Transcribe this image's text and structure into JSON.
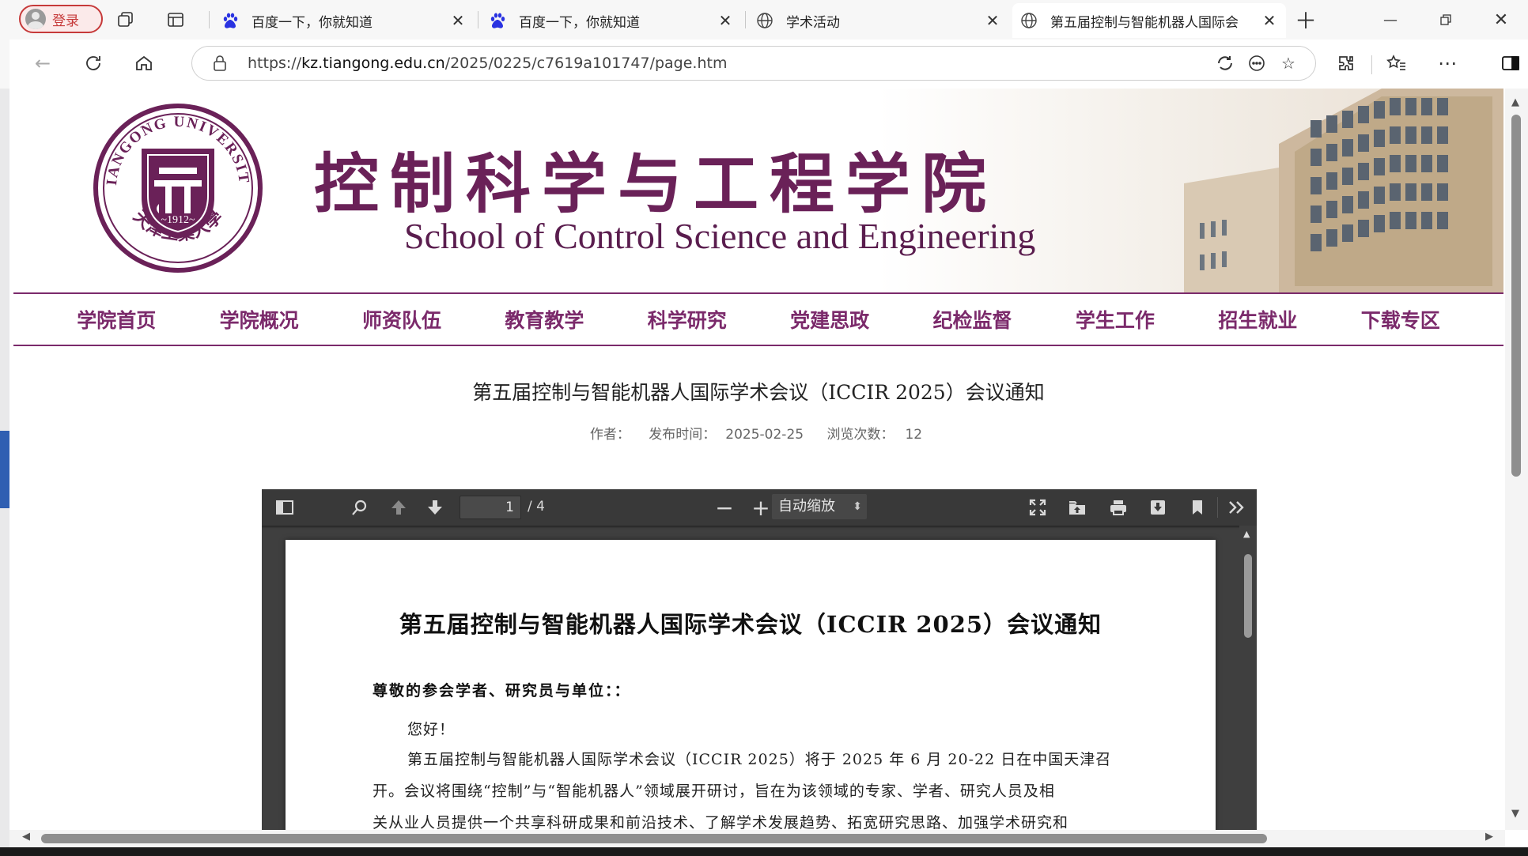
{
  "browser": {
    "profile_label": "登录",
    "tabs": [
      {
        "title": "百度一下，你就知道",
        "icon": "baidu-icon"
      },
      {
        "title": "百度一下，你就知道",
        "icon": "baidu-icon"
      },
      {
        "title": "学术活动",
        "icon": "globe-icon"
      },
      {
        "title": "第五届控制与智能机器人国际会",
        "icon": "globe-icon",
        "active": true
      }
    ],
    "url_prefix": "https://",
    "url_domain": "kz.tiangong.edu.cn",
    "url_path": "/2025/0225/c7619a101747/page.htm"
  },
  "site": {
    "logo_text_top": "TIANGONG UNIVERSITY",
    "logo_year": "~1912~",
    "logo_text_bottom": "天津工業大學",
    "title_cn": "控制科学与工程学院",
    "title_en": "School of Control Science and Engineering",
    "accent_color": "#7b2a6b",
    "menu": [
      "学院首页",
      "学院概况",
      "师资队伍",
      "教育教学",
      "科学研究",
      "党建思政",
      "纪检监督",
      "学生工作",
      "招生就业",
      "下载专区"
    ]
  },
  "article": {
    "title": "第五届控制与智能机器人国际学术会议（ICCIR 2025）会议通知",
    "author_label": "作者：",
    "date_label": "发布时间：",
    "date": "2025-02-25",
    "views_label": "浏览次数：",
    "views": "12"
  },
  "pdf_viewer": {
    "current_page": "1",
    "page_count": "/ 4",
    "zoom": "自动缩放",
    "doc_title": "第五届控制与智能机器人国际学术会议（ICCIR 2025）会议通知",
    "greeting": "尊敬的参会学者、研究员与单位：：",
    "hello": "您好！",
    "paragraph_line1": "第五届控制与智能机器人国际学术会议（ICCIR 2025）将于 2025 年 6 月 20-22 日在中国天津召",
    "paragraph_line2": "开。会议将围绕“控制”与“智能机器人”领域展开研讨，旨在为该领域的专家、学者、研究人员及相",
    "paragraph_line3": "关从业人员提供一个共享科研成果和前沿技术、了解学术发展趋势、拓宽研究思路、加强学术研究和"
  }
}
